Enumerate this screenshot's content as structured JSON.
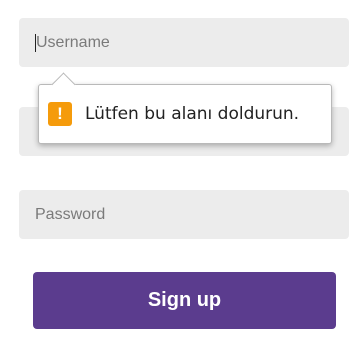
{
  "form": {
    "username_placeholder": "Username",
    "password_placeholder": "Password",
    "signup_label": "Sign up"
  },
  "validation": {
    "message": "Lütfen bu alanı doldurun.",
    "icon": "warning-icon",
    "icon_glyph": "!"
  },
  "colors": {
    "button": "#5b3c8e",
    "field_background": "#ececec",
    "warning": "#f59b0b"
  }
}
